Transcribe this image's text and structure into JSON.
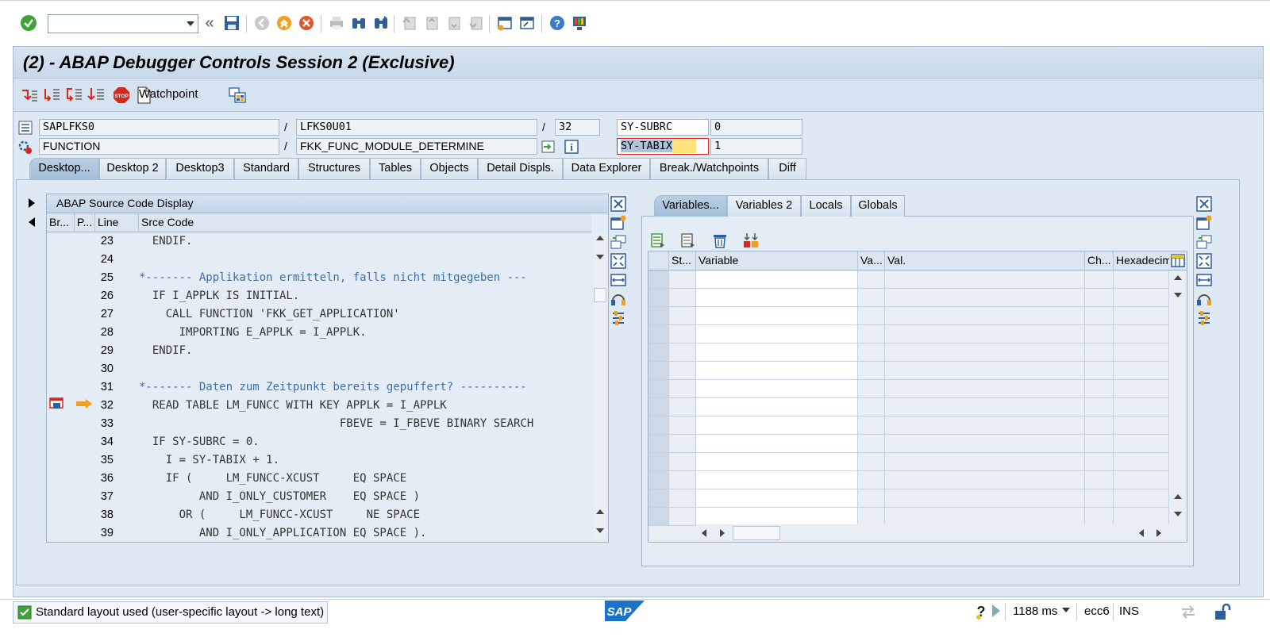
{
  "window": {
    "title": "(2) - ABAP Debugger Controls Session 2 (Exclusive)"
  },
  "toolbar": {
    "command_field_value": "",
    "watchpoint_label": "Watchpoint"
  },
  "fields": {
    "program": "SAPLFKS0",
    "include": "LFKS0U01",
    "line": "32",
    "event_type": "FUNCTION",
    "event_name": "FKK_FUNC_MODULE_DETERMINE",
    "sep": "/",
    "var1_name": "SY-SUBRC",
    "var1_value": "0",
    "var2_name": "SY-TABIX",
    "var2_value": "1"
  },
  "tabs": [
    "Desktop...",
    "Desktop 2",
    "Desktop3",
    "Standard",
    "Structures",
    "Tables",
    "Objects",
    "Detail Displs.",
    "Data Explorer",
    "Break./Watchpoints",
    "Diff"
  ],
  "active_tab": "Desktop...",
  "source": {
    "title": "ABAP Source Code Display",
    "columns": [
      "Br...",
      "P...",
      "Line",
      "Srce Code"
    ],
    "current_line": 32,
    "lines": [
      {
        "n": "23",
        "code": "  ENDIF.",
        "comment": false
      },
      {
        "n": "24",
        "code": "",
        "comment": false
      },
      {
        "n": "25",
        "code": "*------- Applikation ermitteln, falls nicht mitgegeben ---",
        "comment": true
      },
      {
        "n": "26",
        "code": "  IF I_APPLK IS INITIAL.",
        "comment": false
      },
      {
        "n": "27",
        "code": "    CALL FUNCTION 'FKK_GET_APPLICATION'",
        "comment": false
      },
      {
        "n": "28",
        "code": "      IMPORTING E_APPLK = I_APPLK.",
        "comment": false
      },
      {
        "n": "29",
        "code": "  ENDIF.",
        "comment": false
      },
      {
        "n": "30",
        "code": "",
        "comment": false
      },
      {
        "n": "31",
        "code": "*------- Daten zum Zeitpunkt bereits gepuffert? ----------",
        "comment": true
      },
      {
        "n": "32",
        "code": "  READ TABLE LM_FUNCC WITH KEY APPLK = I_APPLK",
        "comment": false
      },
      {
        "n": "33",
        "code": "                              FBEVE = I_FBEVE BINARY SEARCH",
        "comment": false
      },
      {
        "n": "34",
        "code": "  IF SY-SUBRC = 0.",
        "comment": false
      },
      {
        "n": "35",
        "code": "    I = SY-TABIX + 1.",
        "comment": false
      },
      {
        "n": "36",
        "code": "    IF (     LM_FUNCC-XCUST     EQ SPACE",
        "comment": false
      },
      {
        "n": "37",
        "code": "         AND I_ONLY_CUSTOMER    EQ SPACE )",
        "comment": false
      },
      {
        "n": "38",
        "code": "      OR (     LM_FUNCC-XCUST     NE SPACE",
        "comment": false
      },
      {
        "n": "39",
        "code": "         AND I_ONLY_APPLICATION EQ SPACE ).",
        "comment": false
      }
    ]
  },
  "variables": {
    "tabs": [
      "Variables...",
      "Variables 2",
      "Locals",
      "Globals"
    ],
    "active_tab": "Variables...",
    "columns": [
      "St...",
      "Variable",
      "Va...",
      "Val.",
      "Ch...",
      "Hexadecim"
    ]
  },
  "status": {
    "message": "Standard layout used (user-specific layout -> long text)",
    "sap_logo": "SAP",
    "response_time": "1188 ms",
    "system": "ecc6",
    "mode": "INS"
  },
  "colors": {
    "window_bg": "#dfe9f3",
    "comment_blue": "#3a6fb0",
    "highlight_yellow": "#ffe27a",
    "error_red": "#d9261c"
  }
}
